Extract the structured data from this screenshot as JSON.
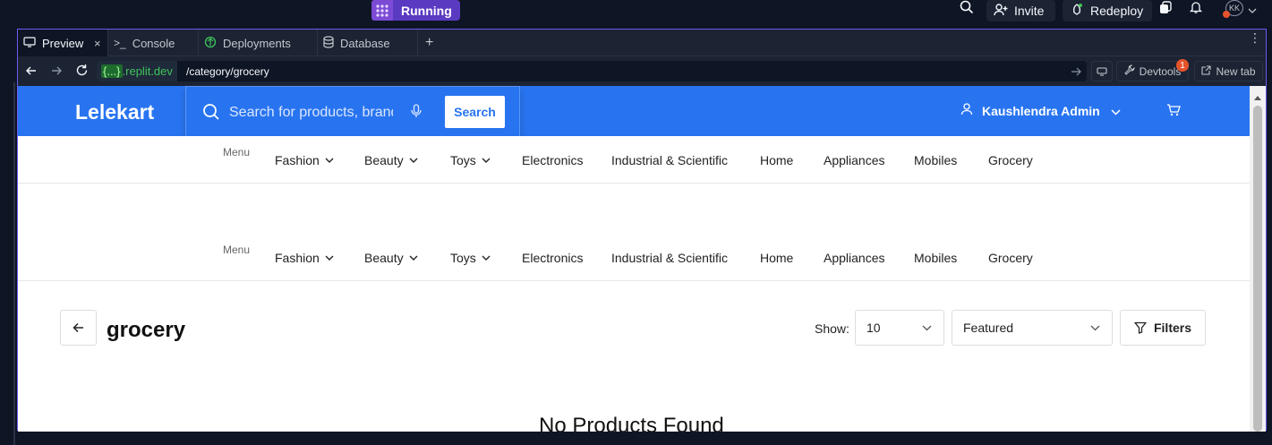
{
  "topbar": {
    "status": "Running",
    "invite": "Invite",
    "redeploy": "Redeploy",
    "avatar_initials": "KK"
  },
  "tabs": [
    {
      "label": "Preview",
      "icon": "monitor-icon"
    },
    {
      "label": "Console",
      "icon": "terminal-icon"
    },
    {
      "label": "Deployments",
      "icon": "deploy-icon"
    },
    {
      "label": "Database",
      "icon": "database-icon"
    }
  ],
  "urlbar": {
    "domain_prefix": "{...}",
    "domain_suffix": ".replit.dev",
    "path": "/category/grocery",
    "devtools": "Devtools",
    "devtools_badge": "1",
    "new_tab": "New tab"
  },
  "site": {
    "brand": "Lelekart",
    "search_placeholder": "Search for products, brands and more",
    "search_button": "Search",
    "user_name": "Kaushlendra Admin",
    "menu_label": "Menu",
    "nav": [
      "Fashion",
      "Beauty",
      "Toys",
      "Electronics",
      "Industrial & Scientific",
      "Home",
      "Appliances",
      "Mobiles",
      "Grocery"
    ],
    "nav_dropdown": [
      true,
      true,
      true,
      false,
      false,
      false,
      false,
      false,
      false
    ],
    "page_title": "grocery",
    "show_label": "Show:",
    "show_value": "10",
    "sort_value": "Featured",
    "filters_label": "Filters",
    "empty_message": "No Products Found"
  },
  "colors": {
    "brand_blue": "#2874f0",
    "ide_bg": "#0e1525",
    "ide_panel": "#1c2333",
    "running_purple": "#5b3ac2"
  }
}
